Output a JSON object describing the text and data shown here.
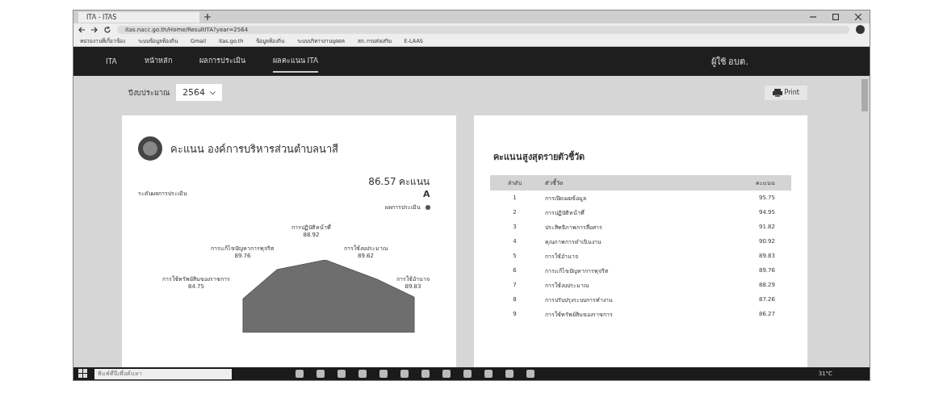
{
  "browser": {
    "tab_title": "ITA - ITAS",
    "url": "itas.nacc.go.th/Home/ResultITA?year=2564",
    "bookmarks": [
      "หน่วยงานที่เกี่ยวข้อง",
      "ระบบข้อมูลท้องถิ่น",
      "Gmail",
      "itas.go.th",
      "ข้อมูลท้องถิ่น",
      "ระบบบริหารงานบุคคล",
      "สถ.กรมส่งเสริม",
      "E-LAAS"
    ]
  },
  "nav": {
    "brand": "ITA",
    "items": [
      {
        "label": "หน้าหลัก",
        "selected": false
      },
      {
        "label": "ผลการประเมิน",
        "selected": false
      },
      {
        "label": "ผลคะแนน ITA",
        "selected": true
      }
    ],
    "user": "ผู้ใช้ อบต."
  },
  "filter": {
    "label": "ปีงบประมาณ",
    "value": "2564"
  },
  "print_button": "Print",
  "score_card": {
    "title": "คะแนน องค์การบริหารส่วนตำบลนาสี",
    "score": "86.57 คะแนน",
    "grade_label": "ระดับผลการประเมิน",
    "grade": "A",
    "legend": "ผลการประเมิน",
    "radar_labels": [
      {
        "name": "การปฏิบัติหน้าที่",
        "value": "88.92"
      },
      {
        "name": "การแก้ไขปัญหาการทุจริต",
        "value": "89.76"
      },
      {
        "name": "การใช้งบประมาณ",
        "value": "89.62"
      },
      {
        "name": "การใช้ทรัพย์สินของราชการ",
        "value": "84.75"
      },
      {
        "name": "การใช้อำนาจ",
        "value": "89.83"
      }
    ]
  },
  "ranking": {
    "title": "คะแนนสูงสุดรายตัวชี้วัด",
    "columns": [
      "ลำดับ",
      "ตัวชี้วัด",
      "คะแนน"
    ],
    "rows": [
      [
        "1",
        "การเปิดเผยข้อมูล",
        "95.75"
      ],
      [
        "2",
        "การปฏิบัติหน้าที่",
        "94.95"
      ],
      [
        "3",
        "ประสิทธิภาพการสื่อสาร",
        "91.82"
      ],
      [
        "4",
        "คุณภาพการดำเนินงาน",
        "90.92"
      ],
      [
        "5",
        "การใช้อำนาจ",
        "89.83"
      ],
      [
        "6",
        "การแก้ไขปัญหาการทุจริต",
        "89.76"
      ],
      [
        "7",
        "การใช้งบประมาณ",
        "88.29"
      ],
      [
        "8",
        "การปรับปรุงระบบการทำงาน",
        "87.26"
      ],
      [
        "9",
        "การใช้ทรัพย์สินของราชการ",
        "86.27"
      ]
    ]
  },
  "taskbar": {
    "search_placeholder": "พิมพ์ที่นี่เพื่อค้นหา",
    "weather": "31°C"
  }
}
